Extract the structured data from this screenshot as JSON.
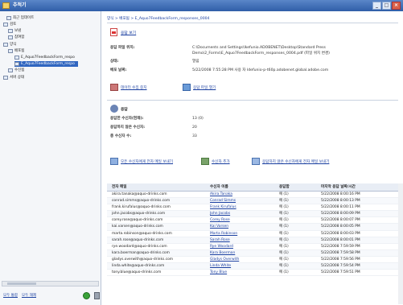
{
  "window": {
    "title": "추적기"
  },
  "sidebar": {
    "items": [
      {
        "label": "최근 업데이트"
      },
      {
        "label": "검토"
      },
      {
        "label": "보냄"
      },
      {
        "label": "참여함"
      },
      {
        "label": "양식"
      },
      {
        "label": "배포됨"
      },
      {
        "label": "E_Aquo7FeedbackForm_respo"
      },
      {
        "label": "E_Aquo7FeedbackForm_respo"
      },
      {
        "label": "수신됨"
      },
      {
        "label": "서버 상태"
      }
    ],
    "footer": {
      "link1": "모두 통합",
      "link2": "모두 해제"
    }
  },
  "main": {
    "breadcrumb": "양식 > 배포됨 > E_Aquo7FeedbackForm_responses_0004",
    "open_file": "응답 보기",
    "details": [
      {
        "key": "응답 파일 위치:",
        "value": "C:\\Documents and Settings\\lkefunio.ADOBENET\\Desktop\\Standard Press Demo\\2_Forms\\E_Aquo7FeedbackForm_responses_0004.pdf (파일 위치 변경)"
      },
      {
        "key": "상태:",
        "value": "열림"
      },
      {
        "key": "배포 날짜:",
        "value": "5/22/2008 7:55:28 PM 사용 자 ldefunio-p-t60p.adobenet.global.adobe.com"
      }
    ],
    "actions1": [
      {
        "label": "데이터 수집 중지"
      },
      {
        "label": "응답 파일 열기"
      }
    ],
    "response_header": "응답",
    "stats": [
      {
        "key": "응답한 수신자(현재):",
        "value": "13 (0)"
      },
      {
        "key": "응답하지 않은 수신자:",
        "value": "20"
      },
      {
        "key": "총 수신자 수:",
        "value": "33"
      }
    ],
    "actions2": [
      {
        "label": "모든 수신자에게 전자 메일 보내기"
      },
      {
        "label": "수신자 추가"
      },
      {
        "label": "응답하지 않은 수신자에게 전자 메일 보내기"
      }
    ],
    "table": {
      "headers": [
        "전자 메일",
        "수신자 이름",
        "응답함",
        "마지막 응답 날짜/시간"
      ],
      "rows": [
        [
          "akira.tanaka@aquo-drinks.com",
          "Akira Tanaka",
          "예 (1)",
          "5/22/2008 8:00:16 PM"
        ],
        [
          "conrad.simms@aquo-drinks.com",
          "Conrad Simms",
          "예 (1)",
          "5/22/2008 8:00:13 PM"
        ],
        [
          "frank.kirufalus@aquo-drinks.com",
          "Frank Kirufalus",
          "예 (1)",
          "5/22/2008 8:00:11 PM"
        ],
        [
          "john.jacobs@aquo-drinks.com",
          "John Jacobs",
          "예 (1)",
          "5/22/2008 8:00:09 PM"
        ],
        [
          "corey.rose@aquo-drinks.com",
          "Corey Rose",
          "예 (1)",
          "5/22/2008 8:00:07 PM"
        ],
        [
          "kai.varsen@aquo-drinks.com",
          "Kai Varsen",
          "예 (1)",
          "5/22/2008 8:00:05 PM"
        ],
        [
          "marta.robinson@aquo-drinks.com",
          "Marta Robinson",
          "예 (1)",
          "5/22/2008 8:00:03 PM"
        ],
        [
          "sarah.rose@aquo-drinks.com",
          "Sarah Rose",
          "예 (1)",
          "5/22/2008 8:00:01 PM"
        ],
        [
          "rye.woodard@aquo-drinks.com",
          "Rye Woodard",
          "예 (1)",
          "5/22/2008 7:59:59 PM"
        ],
        [
          "kara.boerman@aquo-drinks.com",
          "Kara Boerman",
          "예 (1)",
          "5/22/2008 7:59:58 PM"
        ],
        [
          "gladys.overwith@aquo-drinks.com",
          "Gladys Overwith",
          "예 (1)",
          "5/22/2008 7:59:56 PM"
        ],
        [
          "linda.white@aquo-drinks.com",
          "Linda White",
          "예 (1)",
          "5/22/2008 7:59:54 PM"
        ],
        [
          "tony.blue@aquo-drinks.com",
          "Tony Blue",
          "예 (1)",
          "5/22/2008 7:59:51 PM"
        ]
      ]
    }
  }
}
